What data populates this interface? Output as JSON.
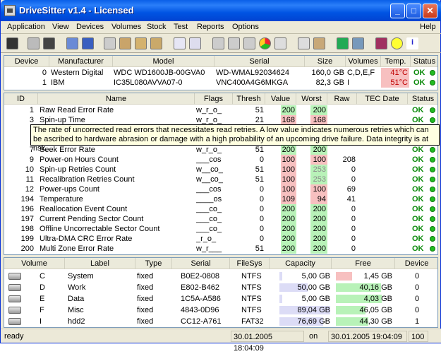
{
  "window": {
    "title": "DriveSitter v1.4 - Licensed"
  },
  "menu": [
    "Application",
    "View",
    "Devices",
    "Volumes",
    "Stock",
    "Test",
    "Reports",
    "Options"
  ],
  "help": "Help",
  "devices": {
    "headers": [
      "Device",
      "Manufacturer",
      "Model",
      "Serial",
      "Size",
      "Volumes",
      "Temp.",
      "Status"
    ],
    "rows": [
      {
        "device": "0",
        "manufacturer": "Western Digital",
        "model": "WDC WD1600JB-00GVA0",
        "serial": "WD-WMAL92034624",
        "size": "160,0 GB",
        "volumes": "C,D,E,F",
        "temp": "41°C",
        "status": "OK"
      },
      {
        "device": "1",
        "manufacturer": "IBM",
        "model": "IC35L080AVVA07-0",
        "serial": "VNC400A4G6MKGA",
        "size": "82,3 GB",
        "volumes": "I",
        "temp": "51°C",
        "status": "OK"
      }
    ]
  },
  "smart": {
    "headers": [
      "ID",
      "Name",
      "Flags",
      "Thresh",
      "Value",
      "Worst",
      "Raw",
      "TEC Date",
      "Status"
    ],
    "rows": [
      {
        "id": "1",
        "name": "Raw Read Error Rate",
        "flags": "w_r_o_",
        "thresh": "51",
        "value": "200",
        "worst": "200",
        "raw": "",
        "status": "OK",
        "vc": "green",
        "wc": "green"
      },
      {
        "id": "3",
        "name": "Spin-up Time",
        "flags": "w_r_o_",
        "thresh": "21",
        "value": "168",
        "worst": "168",
        "raw": "",
        "status": "OK",
        "vc": "red",
        "wc": "red"
      },
      {
        "id": "7",
        "name": "Seek Error Rate",
        "flags": "w_r_o_",
        "thresh": "51",
        "value": "200",
        "worst": "200",
        "raw": "",
        "status": "OK",
        "vc": "green",
        "wc": "green"
      },
      {
        "id": "9",
        "name": "Power-on Hours Count",
        "flags": "___cos",
        "thresh": "0",
        "value": "100",
        "worst": "100",
        "raw": "208",
        "status": "OK",
        "vc": "red",
        "wc": "red"
      },
      {
        "id": "10",
        "name": "Spin-up Retries Count",
        "flags": "w__co_",
        "thresh": "51",
        "value": "100",
        "worst": "253",
        "raw": "0",
        "status": "OK",
        "vc": "red",
        "wc": "green"
      },
      {
        "id": "11",
        "name": "Recalibration Retries Count",
        "flags": "w__co_",
        "thresh": "51",
        "value": "100",
        "worst": "253",
        "raw": "0",
        "status": "OK",
        "vc": "red",
        "wc": "green"
      },
      {
        "id": "12",
        "name": "Power-ups Count",
        "flags": "___cos",
        "thresh": "0",
        "value": "100",
        "worst": "100",
        "raw": "69",
        "status": "OK",
        "vc": "red",
        "wc": "red"
      },
      {
        "id": "194",
        "name": "Temperature",
        "flags": "____os",
        "thresh": "0",
        "value": "109",
        "worst": "94",
        "raw": "41",
        "status": "OK",
        "vc": "red",
        "wc": "red"
      },
      {
        "id": "196",
        "name": "Reallocation Event Count",
        "flags": "___co_",
        "thresh": "0",
        "value": "200",
        "worst": "200",
        "raw": "0",
        "status": "OK",
        "vc": "green",
        "wc": "green"
      },
      {
        "id": "197",
        "name": "Current Pending Sector Count",
        "flags": "___co_",
        "thresh": "0",
        "value": "200",
        "worst": "200",
        "raw": "0",
        "status": "OK",
        "vc": "green",
        "wc": "green"
      },
      {
        "id": "198",
        "name": "Offline Uncorrectable Sector Count",
        "flags": "___co_",
        "thresh": "0",
        "value": "200",
        "worst": "200",
        "raw": "0",
        "status": "OK",
        "vc": "green",
        "wc": "green"
      },
      {
        "id": "199",
        "name": "Ultra-DMA CRC Error Rate",
        "flags": "_r_o_",
        "thresh": "0",
        "value": "200",
        "worst": "200",
        "raw": "0",
        "status": "OK",
        "vc": "green",
        "wc": "green"
      },
      {
        "id": "200",
        "name": "Multi Zone Error Rate",
        "flags": "w_r___",
        "thresh": "51",
        "value": "200",
        "worst": "200",
        "raw": "0",
        "status": "OK",
        "vc": "green",
        "wc": "green"
      }
    ]
  },
  "tooltip": "The rate of uncorrected read errors that necessitates read retries. A low value indicates numerous retries which can be ascribed to hardware abrasion or damage with a high probability of an upcoming drive failure. Data integrity is at risk.",
  "volumes": {
    "headers": [
      "Volume",
      "Label",
      "Type",
      "Serial",
      "FileSys",
      "Capacity",
      "Free",
      "Device"
    ],
    "rows": [
      {
        "volume": "C",
        "label": "System",
        "type": "fixed",
        "serial": "B0E2-0808",
        "fs": "NTFS",
        "capacity": "5,00 GB",
        "cap_pct": 0.06,
        "free": "1,45 GB",
        "free_pct": 0.29,
        "free_color": "red",
        "device": "0"
      },
      {
        "volume": "D",
        "label": "Work",
        "type": "fixed",
        "serial": "E802-B462",
        "fs": "NTFS",
        "capacity": "50,00 GB",
        "cap_pct": 0.56,
        "free": "40,16 GB",
        "free_pct": 0.8,
        "free_color": "green",
        "device": "0"
      },
      {
        "volume": "E",
        "label": "Data",
        "type": "fixed",
        "serial": "1C5A-A586",
        "fs": "NTFS",
        "capacity": "5,00 GB",
        "cap_pct": 0.06,
        "free": "4,03 GB",
        "free_pct": 0.81,
        "free_color": "green",
        "device": "0"
      },
      {
        "volume": "F",
        "label": "Misc",
        "type": "fixed",
        "serial": "4843-0D96",
        "fs": "NTFS",
        "capacity": "89,04 GB",
        "cap_pct": 1.0,
        "free": "46,05 GB",
        "free_pct": 0.52,
        "free_color": "green",
        "device": "0"
      },
      {
        "volume": "I",
        "label": "hdd2",
        "type": "fixed",
        "serial": "CC12-A761",
        "fs": "FAT32",
        "capacity": "76,69 GB",
        "cap_pct": 0.86,
        "free": "44,30 GB",
        "free_pct": 0.58,
        "free_color": "green",
        "device": "1"
      }
    ]
  },
  "status": {
    "left": "ready",
    "time1": "30.01.2005 18:04:09",
    "on": "on",
    "time2": "30.01.2005 19:04:09",
    "count": "100"
  },
  "colors": {
    "ok": "#0b8a0b",
    "red_bg": "#f7c0c0",
    "green_bg": "#b8f2b8",
    "temp_bg": "#f7c0c0"
  }
}
